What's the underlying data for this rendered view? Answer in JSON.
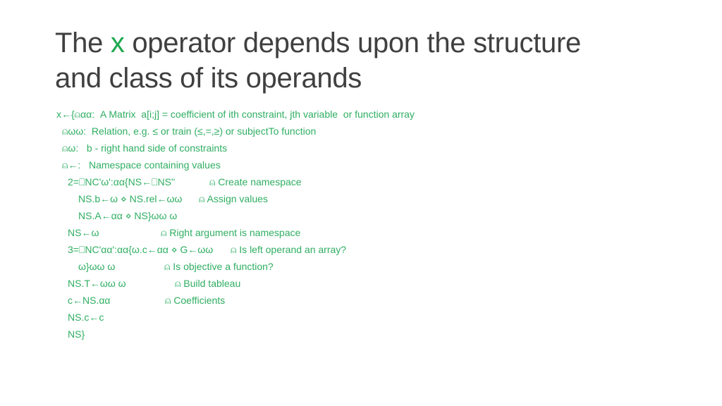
{
  "title": {
    "part1": "The ",
    "operator": "x",
    "part2": " operator depends upon the structure",
    "line2": "and class of its operands"
  },
  "colors": {
    "accent": "#1ea84f",
    "code_text": "#2fae62",
    "title_text": "#404040"
  },
  "code_lines": [
    {
      "code": "x←{⍝αα:  A Matrix  a[i;j] = coefficient of ith constraint, jth variable  or function array",
      "comment": ""
    },
    {
      "code": "⍝ωω:  Relation, e.g. ≤ or train (≤,=,≥) or subjectTo function",
      "comment": ""
    },
    {
      "code": "⍝ω:   b - right hand side of constraints",
      "comment": ""
    },
    {
      "code": "⍝←:   Namespace containing values",
      "comment": ""
    },
    {
      "code": "2=⎕NC'ω':αα{NS←⎕NS''",
      "comment": "⍝ Create namespace"
    },
    {
      "code": "NS.b←ω ⋄ NS.rel←ωω",
      "comment": "⍝ Assign values"
    },
    {
      "code": "NS.A←αα ⋄ NS}ωω ω",
      "comment": ""
    },
    {
      "code": "NS←ω",
      "comment": "⍝ Right argument is namespace"
    },
    {
      "code": "3=⎕NC'αα':αα{ω.c←αα ⋄ G←ωω",
      "comment": "⍝ Is left operand an array?"
    },
    {
      "code": "ω}ωω ω",
      "comment": "⍝ Is objective a function?"
    },
    {
      "code": "NS.T←ωω ω",
      "comment": "⍝ Build tableau"
    },
    {
      "code": "c←NS.αα",
      "comment": "⍝ Coefficients"
    },
    {
      "code": "NS.c←c",
      "comment": ""
    },
    {
      "code": "NS}",
      "comment": ""
    }
  ]
}
